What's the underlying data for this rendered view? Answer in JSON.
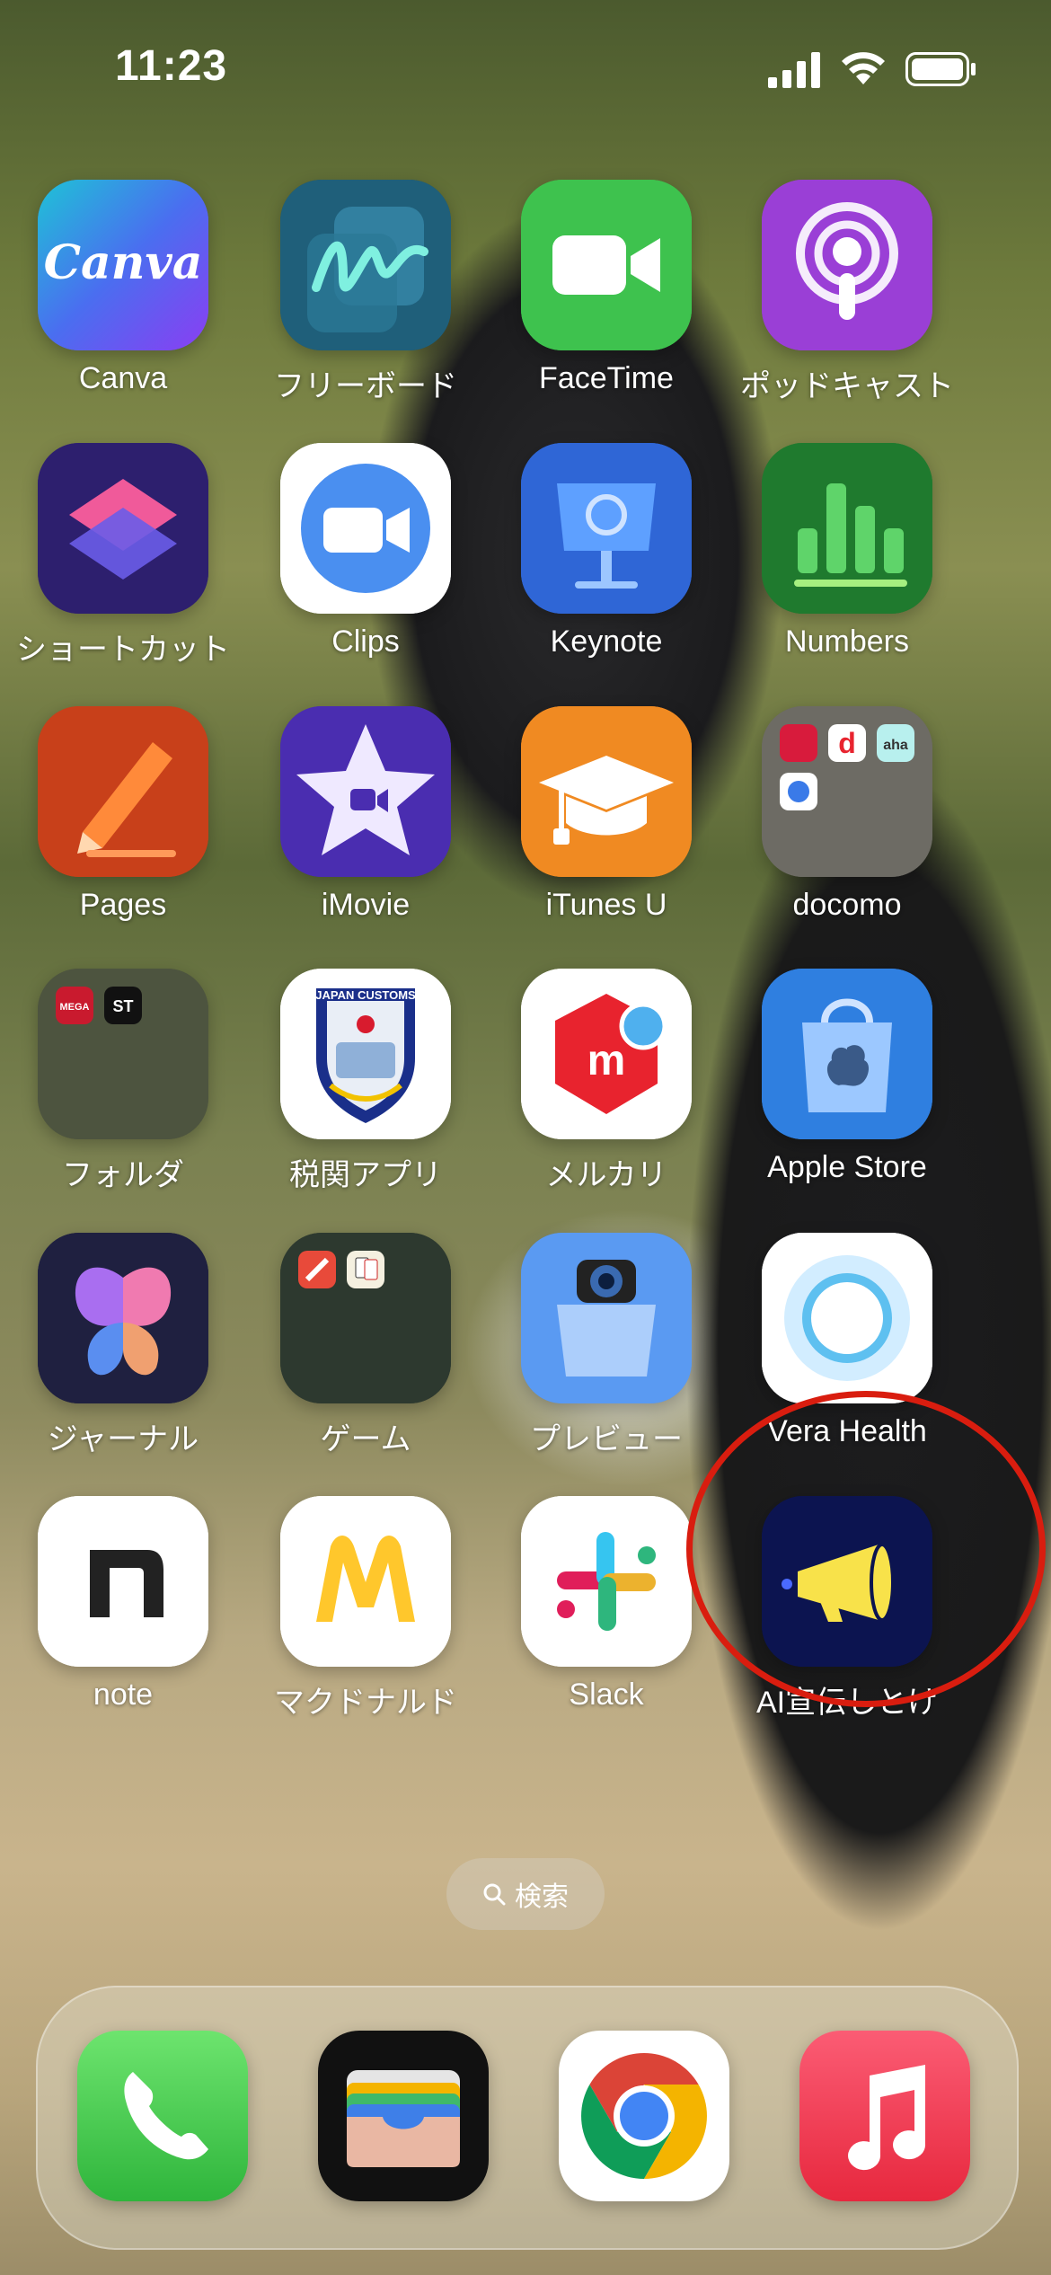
{
  "status_bar": {
    "time": "11:23"
  },
  "apps": [
    {
      "label": "Canva",
      "icon": "canva-icon",
      "bg": "#4c6fe6"
    },
    {
      "label": "フリーボード",
      "icon": "freeform-icon",
      "bg": "#1e4e6a"
    },
    {
      "label": "FaceTime",
      "icon": "facetime-icon",
      "bg": "#3ec24e"
    },
    {
      "label": "ポッドキャスト",
      "icon": "podcasts-icon",
      "bg": "#9a3fd6"
    },
    {
      "label": "ショートカット",
      "icon": "shortcuts-icon",
      "bg": "#3a2a7a"
    },
    {
      "label": "Clips",
      "icon": "clips-icon",
      "bg": "#ffffff"
    },
    {
      "label": "Keynote",
      "icon": "keynote-icon",
      "bg": "#2f66d6"
    },
    {
      "label": "Numbers",
      "icon": "numbers-icon",
      "bg": "#1f7a2e"
    },
    {
      "label": "Pages",
      "icon": "pages-icon",
      "bg": "#c8401a"
    },
    {
      "label": "iMovie",
      "icon": "imovie-icon",
      "bg": "#4a2db0"
    },
    {
      "label": "iTunes U",
      "icon": "itunes-u-icon",
      "bg": "#f08a22"
    },
    {
      "label": "docomo",
      "icon": "docomo-folder-icon",
      "bg": "#6d6b64"
    },
    {
      "label": "フォルダ",
      "icon": "folder-icon",
      "bg": "#4d5540"
    },
    {
      "label": "税関アプリ",
      "icon": "japan-customs-icon",
      "bg": "#ffffff"
    },
    {
      "label": "メルカリ",
      "icon": "mercari-icon",
      "bg": "#ffffff"
    },
    {
      "label": "Apple Store",
      "icon": "apple-store-icon",
      "bg": "#2f7fe0"
    },
    {
      "label": "ジャーナル",
      "icon": "journal-icon",
      "bg": "#1f2040"
    },
    {
      "label": "ゲーム",
      "icon": "games-folder-icon",
      "bg": "#2d3a30"
    },
    {
      "label": "プレビュー",
      "icon": "preview-icon",
      "bg": "#4c8fea"
    },
    {
      "label": "Vera Health",
      "icon": "vera-health-icon",
      "bg": "#ffffff"
    },
    {
      "label": "note",
      "icon": "note-icon",
      "bg": "#ffffff"
    },
    {
      "label": "マクドナルド",
      "icon": "mcdonalds-icon",
      "bg": "#ffffff"
    },
    {
      "label": "Slack",
      "icon": "slack-icon",
      "bg": "#ffffff"
    },
    {
      "label": "AI宣伝しとけ",
      "icon": "megaphone-icon",
      "bg": "#0c1450"
    }
  ],
  "search": {
    "label": "検索"
  },
  "dock": [
    {
      "icon": "phone-icon"
    },
    {
      "icon": "wallet-icon"
    },
    {
      "icon": "chrome-icon"
    },
    {
      "icon": "music-icon"
    }
  ],
  "folder_minis": {
    "docomo": [
      "dポイント",
      "d",
      "aha"
    ],
    "folder": [
      "MEGA SPORTS",
      "ST"
    ]
  },
  "canva_text": "Canva",
  "customs_text": "JAPAN CUSTOMS"
}
